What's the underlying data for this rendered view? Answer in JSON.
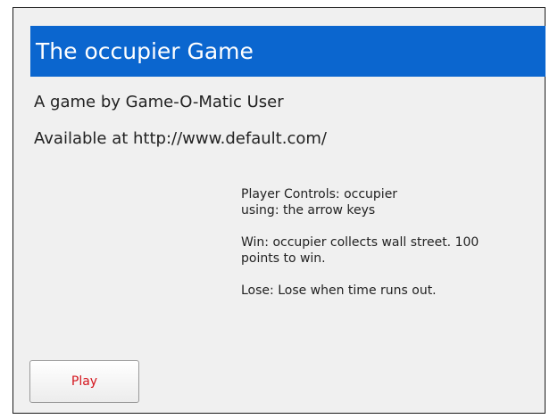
{
  "game": {
    "title": "The occupier Game",
    "author_line": "A game by Game-O-Matic User",
    "availability_line": "Available at http://www.default.com/"
  },
  "instructions": {
    "controls_line1": "Player Controls: occupier",
    "controls_line2": "using: the arrow keys",
    "win_line1": "Win: occupier collects wall street. 100",
    "win_line2": "points to win.",
    "lose": "Lose: Lose when time runs out."
  },
  "buttons": {
    "play_label": "Play"
  },
  "colors": {
    "title_bar": "#0b66cf",
    "background": "#f0f0f0",
    "play_text": "#d4141c"
  }
}
